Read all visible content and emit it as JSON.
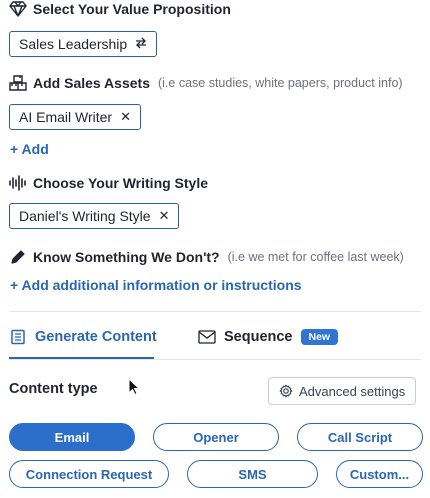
{
  "value_prop": {
    "title": "Select Your Value Proposition",
    "selected": "Sales Leadership",
    "swap_icon": "swap-icon",
    "icon": "diamond-icon"
  },
  "assets": {
    "title": "Add Sales Assets",
    "hint": "(i.e case studies, white papers, product info)",
    "selected": "AI Email Writer",
    "add_label": "+ Add",
    "icon": "boxes-icon"
  },
  "writing_style": {
    "title": "Choose Your Writing Style",
    "selected": "Daniel's Writing Style",
    "icon": "waveform-icon"
  },
  "extra_info": {
    "title": "Know Something We Don't?",
    "hint": "(i.e we met for coffee last week)",
    "add_label": "+ Add additional information or instructions",
    "icon": "pencil-icon"
  },
  "tabs": [
    {
      "label": "Generate Content",
      "icon": "document-icon",
      "active": true
    },
    {
      "label": "Sequence",
      "icon": "envelope-icon",
      "badge": "New"
    }
  ],
  "content_type": {
    "label": "Content type",
    "advanced_label": "Advanced settings",
    "options": [
      "Email",
      "Opener",
      "Call Script",
      "Connection Request",
      "SMS",
      "Custom..."
    ],
    "selected": "Email"
  },
  "colors": {
    "accent": "#2b66b3",
    "badge": "#2f76d2",
    "selected_pill": "#2b6fca"
  },
  "remove_symbol": "✕"
}
